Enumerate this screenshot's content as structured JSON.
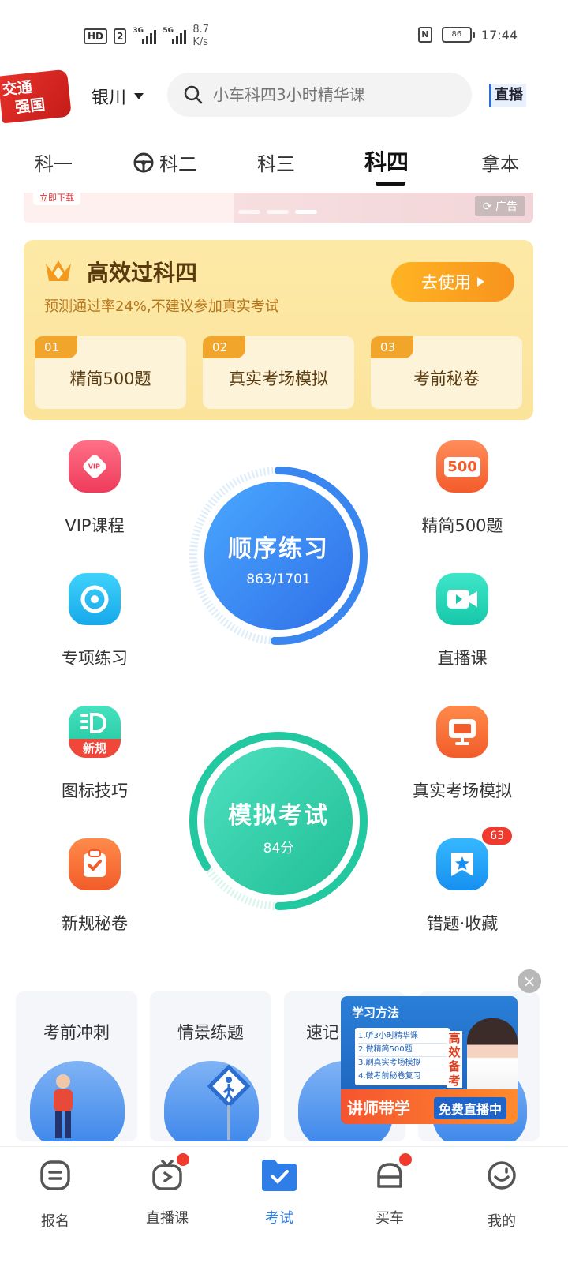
{
  "status_bar": {
    "hd": "HD",
    "hd_num": "2",
    "sig1": "3G",
    "sig2": "5G",
    "speed_value": "8.7",
    "speed_unit": "K/s",
    "nfc": "N",
    "battery": "86",
    "time": "17:44"
  },
  "header": {
    "logo_line1": "交通",
    "logo_line2": "强国",
    "city": "银川",
    "search_placeholder": "小车科四3小时精华课",
    "live": "直播"
  },
  "tabs": [
    {
      "label": "科一"
    },
    {
      "label": "科二"
    },
    {
      "label": "科三"
    },
    {
      "label": "科四"
    },
    {
      "label": "拿本"
    }
  ],
  "banner": {
    "button": "立即下载",
    "ad_tag": "广告"
  },
  "vip": {
    "title": "高效过科四",
    "subtitle": "预测通过率24%,不建议参加真实考试",
    "use_button": "去使用",
    "items": [
      {
        "num": "01",
        "label": "精简500题"
      },
      {
        "num": "02",
        "label": "真实考场模拟"
      },
      {
        "num": "03",
        "label": "考前秘卷"
      }
    ]
  },
  "functions": {
    "vip_course": "VIP课程",
    "vip_icon_text": "VIP",
    "simplified_500": "精简500题",
    "icon_500_text": "500",
    "special_practice": "专项练习",
    "live_course": "直播课",
    "sign_tips": "图标技巧",
    "new_rule_badge": "新规",
    "real_exam_sim": "真实考场模拟",
    "new_rule_paper": "新规秘卷",
    "mistakes_fav": "错题·收藏",
    "mistakes_count": "63"
  },
  "sequential": {
    "label": "顺序练习",
    "progress_text": "863/1701",
    "done": 863,
    "total": 1701
  },
  "mock_exam": {
    "label": "模拟考试",
    "score_text": "84分",
    "score": 84,
    "max": 100
  },
  "quick_cards": [
    {
      "label": "考前冲刺"
    },
    {
      "label": "情景练题"
    },
    {
      "label": "速记"
    }
  ],
  "floating_ad": {
    "head": "学习方法",
    "list": [
      "1.听3小时精华课",
      "2.做精简500题",
      "3.刷真实考场模拟",
      "4.做考前秘卷复习"
    ],
    "side": "高效备考",
    "bottom_left": "讲师带学",
    "bottom_right": "免费直播中",
    "close": "×"
  },
  "bottom_nav": [
    {
      "label": "报名"
    },
    {
      "label": "直播课"
    },
    {
      "label": "考试"
    },
    {
      "label": "买车"
    },
    {
      "label": "我的"
    }
  ],
  "colors": {
    "accent": "#2f7de7",
    "vip_gold": "#f7931e",
    "badge_red": "#f03a2e",
    "seq_blue": "#3a86f0",
    "mock_green": "#2fcfa8"
  }
}
